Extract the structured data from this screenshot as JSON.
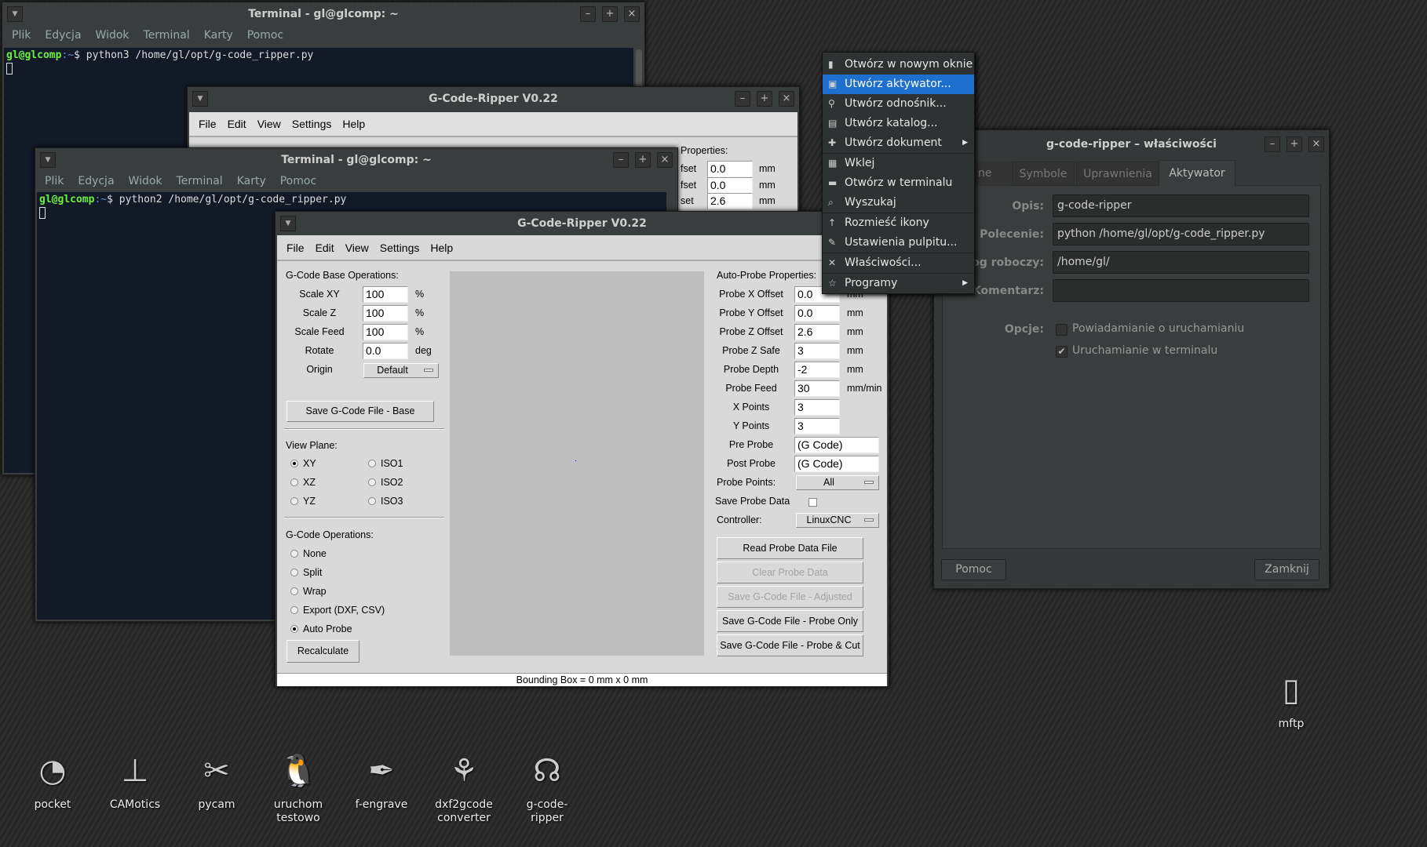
{
  "terminal1": {
    "title": "Terminal - gl@glcomp: ~",
    "menu": [
      "Plik",
      "Edycja",
      "Widok",
      "Terminal",
      "Karty",
      "Pomoc"
    ],
    "prompt_user": "gl@glcomp",
    "prompt_path": ":~",
    "prompt_sym": "$",
    "command": "python3 /home/gl/opt/g-code_ripper.py"
  },
  "terminal2": {
    "title": "Terminal - gl@glcomp: ~",
    "menu": [
      "Plik",
      "Edycja",
      "Widok",
      "Terminal",
      "Karty",
      "Pomoc"
    ],
    "prompt_user": "gl@glcomp",
    "prompt_path": ":~",
    "prompt_sym": "$",
    "command": "python2 /home/gl/opt/g-code_ripper.py"
  },
  "gcr_back": {
    "title": "G-Code-Ripper V0.22",
    "menu": [
      "File",
      "Edit",
      "View",
      "Settings",
      "Help"
    ],
    "header_partial": "Properties:",
    "rows": [
      {
        "label": "fset",
        "value": "0.0",
        "unit": "mm"
      },
      {
        "label": "fset",
        "value": "0.0",
        "unit": "mm"
      },
      {
        "label": "set",
        "value": "2.6",
        "unit": "mm"
      }
    ]
  },
  "gcr": {
    "title": "G-Code-Ripper V0.22",
    "menu": [
      "File",
      "Edit",
      "View",
      "Settings",
      "Help"
    ],
    "base": {
      "header": "G-Code Base Operations:",
      "rows": [
        {
          "label": "Scale XY",
          "value": "100",
          "unit": "%"
        },
        {
          "label": "Scale Z",
          "value": "100",
          "unit": "%"
        },
        {
          "label": "Scale Feed",
          "value": "100",
          "unit": "%"
        },
        {
          "label": "Rotate",
          "value": "0.0",
          "unit": "deg"
        }
      ],
      "origin_label": "Origin",
      "origin_value": "Default",
      "save_button": "Save G-Code File - Base"
    },
    "view_plane": {
      "header": "View Plane:",
      "options": [
        "XY",
        "XZ",
        "YZ",
        "ISO1",
        "ISO2",
        "ISO3"
      ],
      "selected": "XY"
    },
    "operations": {
      "header": "G-Code Operations:",
      "options": [
        "None",
        "Split",
        "Wrap",
        "Export (DXF, CSV)",
        "Auto Probe"
      ],
      "selected": "Auto Probe",
      "recalc": "Recalculate"
    },
    "probe": {
      "header": "Auto-Probe Properties:",
      "rows": [
        {
          "label": "Probe X Offset",
          "value": "0.0",
          "unit": "mm"
        },
        {
          "label": "Probe Y Offset",
          "value": "0.0",
          "unit": "mm"
        },
        {
          "label": "Probe Z Offset",
          "value": "2.6",
          "unit": "mm"
        },
        {
          "label": "Probe Z Safe",
          "value": "3",
          "unit": "mm"
        },
        {
          "label": "Probe Depth",
          "value": "-2",
          "unit": "mm"
        },
        {
          "label": "Probe Feed",
          "value": "30",
          "unit": "mm/min"
        },
        {
          "label": "X Points",
          "value": "3",
          "unit": ""
        },
        {
          "label": "Y Points",
          "value": "3",
          "unit": ""
        }
      ],
      "pre_probe_label": "Pre Probe",
      "pre_probe": "(G Code)",
      "post_probe_label": "Post Probe",
      "post_probe": "(G Code)",
      "points_label": "Probe Points:",
      "points_value": "All",
      "save_data_label": "Save Probe Data",
      "save_data_checked": false,
      "controller_label": "Controller:",
      "controller_value": "LinuxCNC",
      "buttons": [
        {
          "label": "Read Probe Data File",
          "enabled": true
        },
        {
          "label": "Clear Probe Data",
          "enabled": false
        },
        {
          "label": "Save G-Code File - Adjusted",
          "enabled": false
        },
        {
          "label": "Save G-Code File - Probe Only",
          "enabled": true
        },
        {
          "label": "Save G-Code File - Probe & Cut",
          "enabled": true
        }
      ]
    },
    "status": "Bounding Box = 0 mm  x 0 mm"
  },
  "context_menu": {
    "items": [
      {
        "label": "Otwórz w nowym oknie",
        "icon": "window-icon"
      },
      {
        "label": "Utwórz aktywator...",
        "icon": "launcher-icon",
        "selected": true
      },
      {
        "label": "Utwórz odnośnik...",
        "icon": "link-icon"
      },
      {
        "label": "Utwórz katalog...",
        "icon": "folder-icon"
      },
      {
        "label": "Utwórz dokument",
        "icon": "document-icon",
        "submenu": true
      },
      {
        "label": "Wklej",
        "icon": "paste-icon"
      },
      {
        "label": "Otwórz w terminalu",
        "icon": "terminal-icon"
      },
      {
        "label": "Wyszukaj",
        "icon": "search-icon"
      },
      {
        "label": "Rozmieść ikony",
        "icon": "arrange-icon"
      },
      {
        "label": "Ustawienia pulpitu...",
        "icon": "desktop-settings-icon"
      },
      {
        "label": "Właściwości...",
        "icon": "properties-icon"
      },
      {
        "label": "Programy",
        "icon": "star-icon",
        "submenu": true
      }
    ]
  },
  "properties": {
    "title": "g-code-ripper – właściwości",
    "tabs": [
      "ne",
      "Symbole",
      "Uprawnienia",
      "Aktywator"
    ],
    "active_tab": "Aktywator",
    "fields": [
      {
        "label": "Opis:",
        "value": "g-code-ripper"
      },
      {
        "label": "Polecenie:",
        "value": "python /home/gl/opt/g-code_ripper.py"
      },
      {
        "label": "log roboczy:",
        "value": "/home/gl/"
      },
      {
        "label": "Komentarz:",
        "value": ""
      }
    ],
    "options_label": "Opcje:",
    "options": [
      {
        "label": "Powiadamianie o uruchamianiu",
        "checked": false
      },
      {
        "label": "Uruchamianie w terminalu",
        "checked": true
      }
    ],
    "help_button": "Pomoc",
    "close_button": "Zamknij"
  },
  "desktop_icons": [
    {
      "label": "pocket",
      "icon": "rss-icon"
    },
    {
      "label": "CAMotics",
      "icon": "tool-icon"
    },
    {
      "label": "pycam",
      "icon": "scissors-icon"
    },
    {
      "label": "uruchom testowo",
      "icon": "tux-icon"
    },
    {
      "label": "f-engrave",
      "icon": "pen-icon"
    },
    {
      "label": "dxf2gcode converter",
      "icon": "knot-icon"
    },
    {
      "label": "g-code-ripper",
      "icon": "headphones-icon"
    },
    {
      "label": "mftp",
      "icon": "file-icon"
    }
  ]
}
